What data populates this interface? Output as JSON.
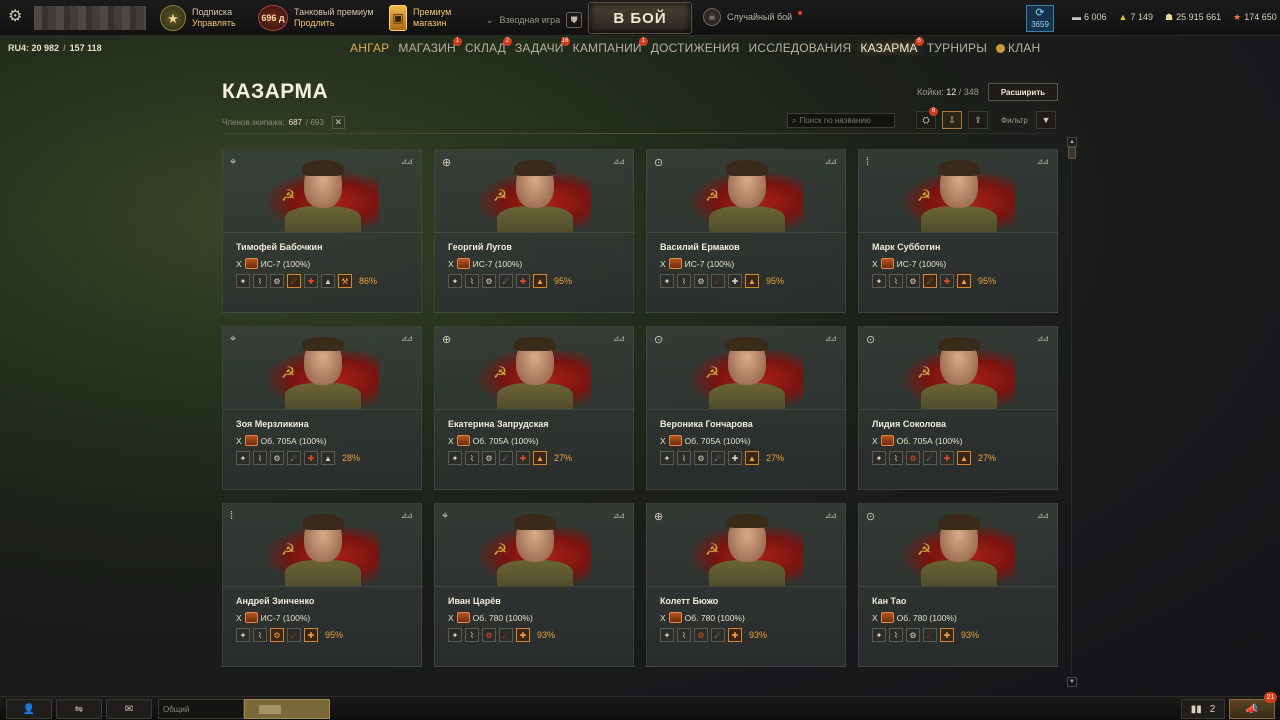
{
  "topbar": {
    "subscription": {
      "label": "Подписка",
      "sub": "Управлять",
      "icon": "star-badge-icon"
    },
    "premium_days": {
      "value": "696 д",
      "icon": "premium-badge-icon"
    },
    "tank_premium": {
      "label": "Танковый премиум",
      "sub": "Продлить"
    },
    "premium_shop": {
      "label": "Премиум",
      "sub": "магазин",
      "icon": "premium-shop-icon"
    },
    "platoon": {
      "label": "Взводная игра"
    },
    "battle_button": "В БОЙ",
    "battle_mode": "Случайный бой",
    "session": {
      "value": "3659",
      "icon": "session-stats-icon"
    },
    "currencies": [
      {
        "icon": "bonds-icon",
        "value": "6 006"
      },
      {
        "icon": "gold-icon",
        "value": "7 149"
      },
      {
        "icon": "credits-icon",
        "value": "25 915 661"
      },
      {
        "icon": "free-xp-icon",
        "value": "174 650"
      }
    ]
  },
  "account": {
    "server": "RU4:",
    "online": "20 982",
    "total": "157 118"
  },
  "nav": [
    {
      "label": "АНГАР",
      "gold": true
    },
    {
      "label": "МАГАЗИН",
      "badge": "1"
    },
    {
      "label": "СКЛАД",
      "badge": "2"
    },
    {
      "label": "ЗАДАЧИ",
      "badge": "16"
    },
    {
      "label": "КАМПАНИИ",
      "badge": "1"
    },
    {
      "label": "ДОСТИЖЕНИЯ"
    },
    {
      "label": "ИССЛЕДОВАНИЯ"
    },
    {
      "label": "КАЗАРМА",
      "badge": "6",
      "active": true
    },
    {
      "label": "ТУРНИРЫ"
    },
    {
      "label": "КЛАН",
      "clan": true
    }
  ],
  "page": {
    "title": "КАЗАРМА",
    "crew_label": "Членов экипажа:",
    "crew_count": "687",
    "crew_total": "/ 693",
    "bunks_label": "Койки:",
    "bunks_used": "12",
    "bunks_total": "/ 348",
    "expand_button": "Расширить",
    "search_placeholder": "Поиск по названию",
    "filter_label": "Фильтр",
    "filter_badge": "6"
  },
  "crew": [
    {
      "name": "Тимофей Бабочкин",
      "role": "radio-operator-icon",
      "tier": "X",
      "vehicle": "ИС-7 (100%)",
      "skills": [
        "sk",
        "sk",
        "sk",
        "orange-sk",
        "red-sk",
        "sk",
        "orange-sk"
      ],
      "pct": "86%"
    },
    {
      "name": "Георгий Лугов",
      "role": "gunner-icon",
      "tier": "X",
      "vehicle": "ИС-7 (100%)",
      "skills": [
        "sk",
        "sk",
        "sk",
        "sk",
        "red-sk",
        "orange-sk"
      ],
      "pct": "95%"
    },
    {
      "name": "Василий Ермаков",
      "role": "driver-icon",
      "tier": "X",
      "vehicle": "ИС-7 (100%)",
      "skills": [
        "sk",
        "sk",
        "sk",
        "red-sk",
        "sk",
        "orange-sk"
      ],
      "pct": "95%"
    },
    {
      "name": "Марк Субботин",
      "role": "loader-icon",
      "tier": "X",
      "vehicle": "ИС-7 (100%)",
      "skills": [
        "sk",
        "sk",
        "sk",
        "orange-sk",
        "red-sk",
        "orange-sk"
      ],
      "pct": "95%"
    },
    {
      "name": "Зоя Мерзликина",
      "role": "radio-operator-icon",
      "tier": "X",
      "vehicle": "Об. 705А (100%)",
      "skills": [
        "sk",
        "sk",
        "sk",
        "sk",
        "red-sk",
        "sk"
      ],
      "pct": "28%"
    },
    {
      "name": "Екатерина Запрудская",
      "role": "gunner-icon",
      "tier": "X",
      "vehicle": "Об. 705А (100%)",
      "skills": [
        "sk",
        "sk",
        "sk",
        "sk",
        "red-sk",
        "orange-sk"
      ],
      "pct": "27%"
    },
    {
      "name": "Вероника Гончарова",
      "role": "driver-icon",
      "tier": "X",
      "vehicle": "Об. 705А (100%)",
      "skills": [
        "sk",
        "sk",
        "sk",
        "sk",
        "sk",
        "orange-sk"
      ],
      "pct": "27%"
    },
    {
      "name": "Лидия Соколова",
      "role": "commander-icon",
      "tier": "X",
      "vehicle": "Об. 705А (100%)",
      "skills": [
        "sk",
        "sk",
        "red-sk",
        "sk",
        "red-sk",
        "orange-sk"
      ],
      "pct": "27%"
    },
    {
      "name": "Андрей Зинченко",
      "role": "loader-icon",
      "tier": "X",
      "vehicle": "ИС-7 (100%)",
      "skills": [
        "sk",
        "sk",
        "orange-sk",
        "red-sk",
        "orange-sk"
      ],
      "pct": "95%"
    },
    {
      "name": "Иван Царёв",
      "role": "radio-operator-icon",
      "tier": "X",
      "vehicle": "Об. 780 (100%)",
      "skills": [
        "sk",
        "sk",
        "red-sk",
        "red-sk",
        "orange-sk"
      ],
      "pct": "93%"
    },
    {
      "name": "Колетт Бюжо",
      "role": "gunner-icon",
      "tier": "X",
      "vehicle": "Об. 780 (100%)",
      "skills": [
        "sk",
        "sk",
        "red-sk",
        "sk",
        "orange-sk"
      ],
      "pct": "93%"
    },
    {
      "name": "Кан Тао",
      "role": "driver-icon",
      "tier": "X",
      "vehicle": "Об. 780 (100%)",
      "skills": [
        "sk",
        "sk",
        "sk",
        "red-sk",
        "orange-sk"
      ],
      "pct": "93%"
    }
  ],
  "bottom": {
    "channel": "Общий",
    "battle_results_count": "2",
    "messages_badge": "21"
  }
}
